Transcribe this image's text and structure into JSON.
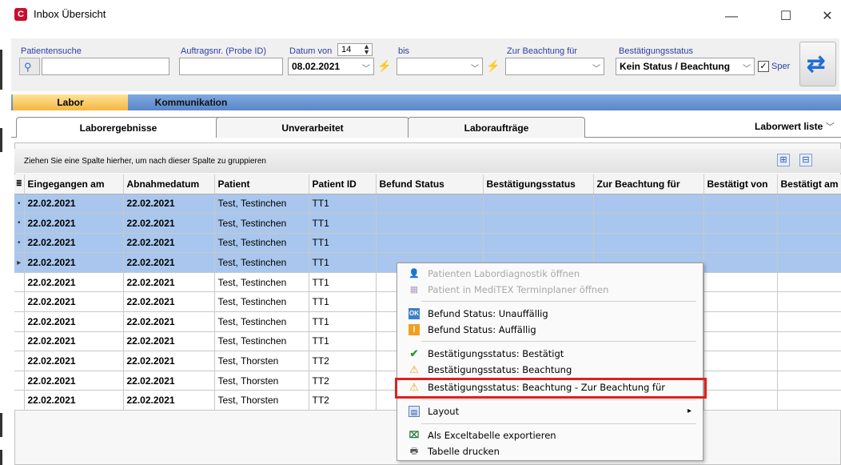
{
  "window": {
    "title": "Inbox Übersicht",
    "app_icon": "C",
    "min_label": "—",
    "max_label": "☐",
    "close_label": "✕"
  },
  "filters": {
    "patient_search_label": "Patientensuche",
    "patient_search_value": "",
    "order_no_label": "Auftragsnr. (Probe ID)",
    "order_no_value": "",
    "date_from_label": "Datum von",
    "date_from_days": "14",
    "date_from_value": "08.02.2021",
    "date_to_label": "bis",
    "date_to_value": "",
    "attention_for_label": "Zur Beachtung für",
    "attention_for_value": "",
    "confirm_status_label": "Bestätigungsstatus",
    "confirm_status_value": "Kein Status / Beachtung",
    "lock_checkbox_label": "Sper"
  },
  "main_tabs": [
    {
      "label": "Labor",
      "active": true
    },
    {
      "label": "Kommunikation",
      "active": false
    }
  ],
  "sub_tabs": [
    {
      "label": "Laborergebnisse",
      "active": true
    },
    {
      "label": "Unverarbeitet",
      "active": false
    },
    {
      "label": "Laboraufträge",
      "active": false
    }
  ],
  "laborwert_liste": "Laborwert liste",
  "group_hint": "Ziehen Sie eine Spalte hierher, um nach dieser Spalte zu gruppieren",
  "table": {
    "columns": [
      "Eingegangen am",
      "Abnahmedatum",
      "Patient",
      "Patient ID",
      "Befund Status",
      "Bestätigungsstatus",
      "Zur Beachtung für",
      "Bestätigt von",
      "Bestätigt am"
    ],
    "rows": [
      {
        "ind": "•",
        "selected": true,
        "cells": [
          "22.02.2021",
          "22.02.2021",
          "Test, Testinchen",
          "TT1",
          "",
          "",
          "",
          "",
          ""
        ]
      },
      {
        "ind": "•",
        "selected": true,
        "cells": [
          "22.02.2021",
          "22.02.2021",
          "Test, Testinchen",
          "TT1",
          "",
          "",
          "",
          "",
          ""
        ]
      },
      {
        "ind": "•",
        "selected": true,
        "cells": [
          "22.02.2021",
          "22.02.2021",
          "Test, Testinchen",
          "TT1",
          "",
          "",
          "",
          "",
          ""
        ]
      },
      {
        "ind": "▸",
        "selected": true,
        "cells": [
          "22.02.2021",
          "22.02.2021",
          "Test, Testinchen",
          "TT1",
          "",
          "",
          "",
          "",
          ""
        ]
      },
      {
        "ind": "",
        "selected": false,
        "cells": [
          "22.02.2021",
          "22.02.2021",
          "Test, Testinchen",
          "TT1",
          "",
          "",
          "",
          "",
          ""
        ]
      },
      {
        "ind": "",
        "selected": false,
        "cells": [
          "22.02.2021",
          "22.02.2021",
          "Test, Testinchen",
          "TT1",
          "",
          "",
          "",
          "",
          ""
        ]
      },
      {
        "ind": "",
        "selected": false,
        "cells": [
          "22.02.2021",
          "22.02.2021",
          "Test, Testinchen",
          "TT1",
          "",
          "",
          "",
          "",
          ""
        ]
      },
      {
        "ind": "",
        "selected": false,
        "cells": [
          "22.02.2021",
          "22.02.2021",
          "Test, Testinchen",
          "TT1",
          "",
          "",
          "",
          "",
          ""
        ]
      },
      {
        "ind": "",
        "selected": false,
        "cells": [
          "22.02.2021",
          "22.02.2021",
          "Test, Thorsten",
          "TT2",
          "",
          "",
          "",
          "",
          ""
        ]
      },
      {
        "ind": "",
        "selected": false,
        "cells": [
          "22.02.2021",
          "22.02.2021",
          "Test, Thorsten",
          "TT2",
          "",
          "",
          "",
          "",
          ""
        ]
      },
      {
        "ind": "",
        "selected": false,
        "cells": [
          "22.02.2021",
          "22.02.2021",
          "Test, Thorsten",
          "TT2",
          "",
          "",
          "",
          "",
          ""
        ]
      }
    ]
  },
  "context_menu": {
    "items": [
      {
        "label": "Patienten Labordiagnostik öffnen",
        "icon": "user-icon",
        "disabled": true
      },
      {
        "label": "Patient in MediTEX Terminplaner öffnen",
        "icon": "calendar-icon",
        "disabled": true
      },
      {
        "label": "Befund Status: Unauffällig",
        "icon": "ok-status-icon",
        "disabled": false
      },
      {
        "label": "Befund Status: Auffällig",
        "icon": "alert-status-icon",
        "disabled": false
      },
      {
        "label": "Bestätigungsstatus: Bestätigt",
        "icon": "checkmark-icon",
        "disabled": false
      },
      {
        "label": "Bestätigungsstatus: Beachtung",
        "icon": "warning-icon",
        "disabled": false
      },
      {
        "label": "Bestätigungsstatus: Beachtung - Zur Beachtung für",
        "icon": "warning-icon",
        "disabled": false
      },
      {
        "label": "Layout",
        "icon": "layout-icon",
        "disabled": false,
        "submenu": true
      },
      {
        "label": "Als Exceltabelle exportieren",
        "icon": "excel-icon",
        "disabled": false
      },
      {
        "label": "Tabelle drucken",
        "icon": "printer-icon",
        "disabled": false
      }
    ],
    "submenu_arrow": "▸"
  },
  "colors": {
    "selected_row": "#a9c7ee",
    "active_main_tab": "#f4b63f",
    "main_tab_bar": "#5a86c8",
    "highlight_box": "#e0201c"
  }
}
